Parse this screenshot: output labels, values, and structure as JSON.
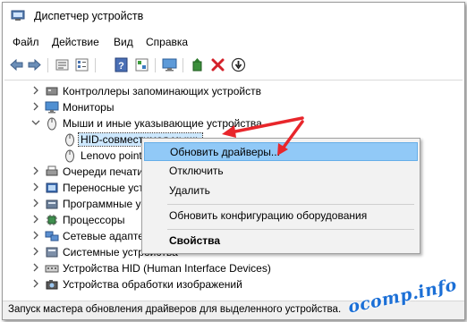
{
  "window": {
    "title": "Диспетчер устройств"
  },
  "menu": [
    "Файл",
    "Действие",
    "Вид",
    "Справка"
  ],
  "toolbar_icons": [
    "back-arrow-icon",
    "forward-arrow-icon",
    "properties-icon",
    "list-view-icon",
    "help-icon",
    "resources-icon",
    "monitor-icon",
    "update-driver-icon",
    "remove-device-icon",
    "scan-hardware-icon"
  ],
  "tree": {
    "cat_storage": "Контроллеры запоминающих устройств",
    "cat_monitors": "Мониторы",
    "cat_mice": "Мыши и иные указывающие устройства",
    "dev_hid": "HID-совместимая мышь",
    "dev_lenovo": "Lenovo pointing device",
    "cat_print": "Очереди печати",
    "cat_portable": "Переносные устройства",
    "cat_software": "Программные устройства",
    "cat_cpu": "Процессоры",
    "cat_net": "Сетевые адаптеры",
    "cat_system": "Системные устройства",
    "cat_hid": "Устройства HID (Human Interface Devices)",
    "cat_imaging": "Устройства обработки изображений"
  },
  "context_menu": {
    "update": "Обновить драйверы...",
    "disable": "Отключить",
    "remove": "Удалить",
    "scan": "Обновить конфигурацию оборудования",
    "properties": "Свойства"
  },
  "status": "Запуск мастера обновления драйверов для выделенного устройства.",
  "watermark": "ocomp.info",
  "colors": {
    "highlight": "#91c9f7",
    "arrow": "#e8262b",
    "selection": "#cde8ff"
  }
}
